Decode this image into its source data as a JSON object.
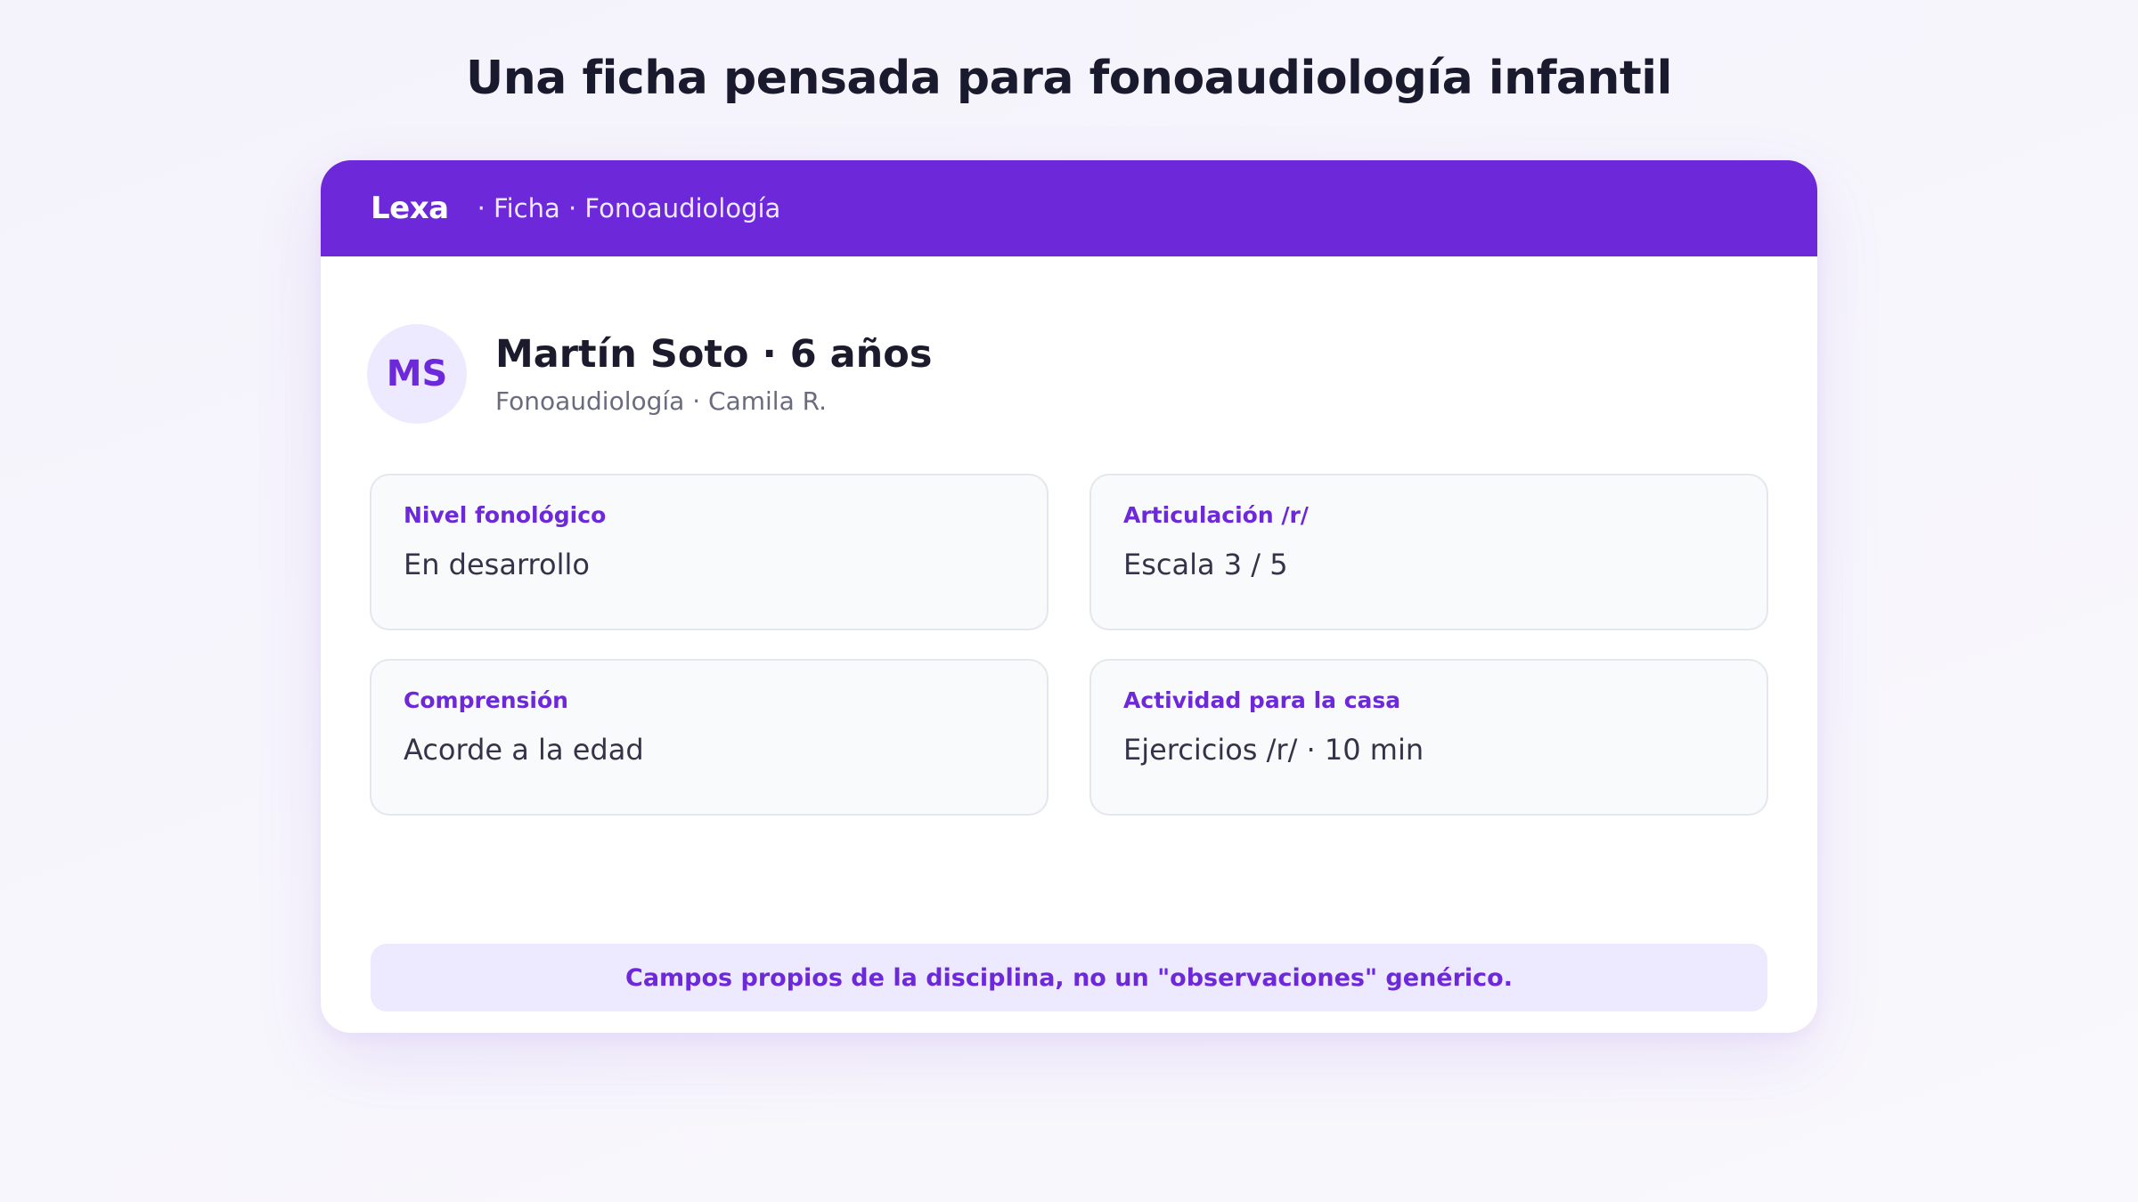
{
  "headline": "Una ficha pensada para fonoaudiología infantil",
  "header": {
    "brand": "Lexa",
    "breadcrumb": "· Ficha · Fonoaudiología"
  },
  "patient": {
    "initials": "MS",
    "name": "Martín Soto · 6 años",
    "subtitle": "Fonoaudiología · Camila R."
  },
  "fields": [
    {
      "label": "Nivel fonológico",
      "value": "En desarrollo"
    },
    {
      "label": "Articulación /r/",
      "value": "Escala 3 / 5"
    },
    {
      "label": "Comprensión",
      "value": "Acorde a la edad"
    },
    {
      "label": "Actividad para la casa",
      "value": "Ejercicios /r/ · 10 min"
    }
  ],
  "footer_note": "Campos propios de la disciplina, no un \"observaciones\" genérico.",
  "colors": {
    "accent": "#6d28d9",
    "accent_soft": "#ede9fe",
    "text_dark": "#1c1b2e",
    "text_muted": "#6b6b7e",
    "field_bg": "#f9fafb",
    "field_border": "#e5e7ee"
  }
}
